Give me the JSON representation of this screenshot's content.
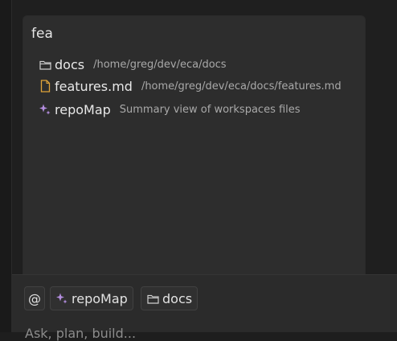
{
  "completion": {
    "query": "fea",
    "items": [
      {
        "icon": "folder-icon",
        "name": "docs",
        "detail": "/home/greg/dev/eca/docs"
      },
      {
        "icon": "file-icon",
        "name": "features.md",
        "detail": "/home/greg/dev/eca/docs/features.md"
      },
      {
        "icon": "sparkle-icon",
        "name": "repoMap",
        "detail": "Summary view of workspaces files"
      }
    ]
  },
  "composer": {
    "at_label": "@",
    "contexts": [
      {
        "icon": "sparkle-icon",
        "label": "repoMap"
      },
      {
        "icon": "folder-icon",
        "label": "docs"
      }
    ],
    "placeholder": "Ask, plan, build..."
  },
  "colors": {
    "sparkle": "#b48ee0",
    "file": "#e0a43a",
    "folder": "#cfcfcf"
  }
}
